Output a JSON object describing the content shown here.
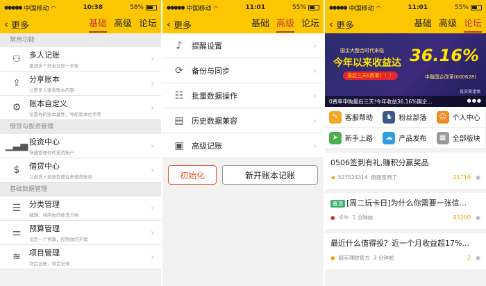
{
  "status": {
    "carrier": "中国移动",
    "p1": {
      "time": "10:38",
      "battery": "58%"
    },
    "p2": {
      "time": "11:01",
      "battery": "55%"
    },
    "p3": {
      "time": "11:01",
      "battery": "55%"
    }
  },
  "nav": {
    "back_label": "更多",
    "tabs": [
      "基础",
      "高级",
      "论坛"
    ]
  },
  "panel1": {
    "sections": [
      {
        "title": "常用功能",
        "items": [
          {
            "title": "多人记账",
            "sub": "邀请多个好友记同一本账"
          },
          {
            "title": "分享账本",
            "sub": "让更多人查看账本内容"
          },
          {
            "title": "账本自定义",
            "sub": "设置你的账本属性、导航和本位币等"
          }
        ]
      },
      {
        "title": "借贷与投资管理",
        "items": [
          {
            "title": "投资中心",
            "sub": "快速管理你的投资账户"
          },
          {
            "title": "借贷中心",
            "sub": "以借贷人视角管理往来借贷账单"
          }
        ]
      },
      {
        "title": "基础数据管理",
        "items": [
          {
            "title": "分类管理",
            "sub": "编辑、排序你的收支分类"
          },
          {
            "title": "预算管理",
            "sub": "设定一个预算，控制你的开销"
          },
          {
            "title": "项目管理",
            "sub": "项目记账，项目记录"
          }
        ]
      }
    ]
  },
  "panel2": {
    "items": [
      "提醒设置",
      "备份与同步",
      "批量数据操作",
      "历史数据兼容",
      "高级记账"
    ],
    "init_button": "初始化",
    "new_book_button": "新开账本记账"
  },
  "panel3": {
    "banner": {
      "line1": "国企大整合时代来临",
      "headline": "今年以来收益达",
      "percent": "36.16%",
      "pill": "最后三天0费率！！！",
      "fund": "中融国企改革(000628)",
      "investing": "投资需谨慎",
      "caption": "0费率申购最后三天!今年收益36.16%国企..."
    },
    "grid": [
      {
        "label": "客服帮助",
        "color": "#f5a623",
        "glyph": "✎"
      },
      {
        "label": "粉丝部落",
        "color": "#3a5a8c",
        "glyph": "♞"
      },
      {
        "label": "个人中心",
        "color": "#f08a24",
        "glyph": "☺"
      },
      {
        "label": "新手上路",
        "color": "#4caf50",
        "glyph": "➤"
      },
      {
        "label": "产品发布",
        "color": "#2f9ee0",
        "glyph": "☁"
      },
      {
        "label": "全部版块",
        "color": "#999999",
        "glyph": "▦"
      }
    ],
    "posts": [
      {
        "title": "0506签到有礼,赚积分赢奖品",
        "author": "527524314",
        "time": "刚刚签到了",
        "count": "21719"
      },
      {
        "tag": "置顶",
        "title": "[周二玩卡日]为什么你需要一张信...",
        "author": "卡牛",
        "time": "1 分钟前",
        "count": "85200"
      },
      {
        "title": "最近什么值得投？近一个月收益超17%...",
        "author": "随手理财官方",
        "time": "3 分钟前",
        "count": "2"
      }
    ]
  }
}
